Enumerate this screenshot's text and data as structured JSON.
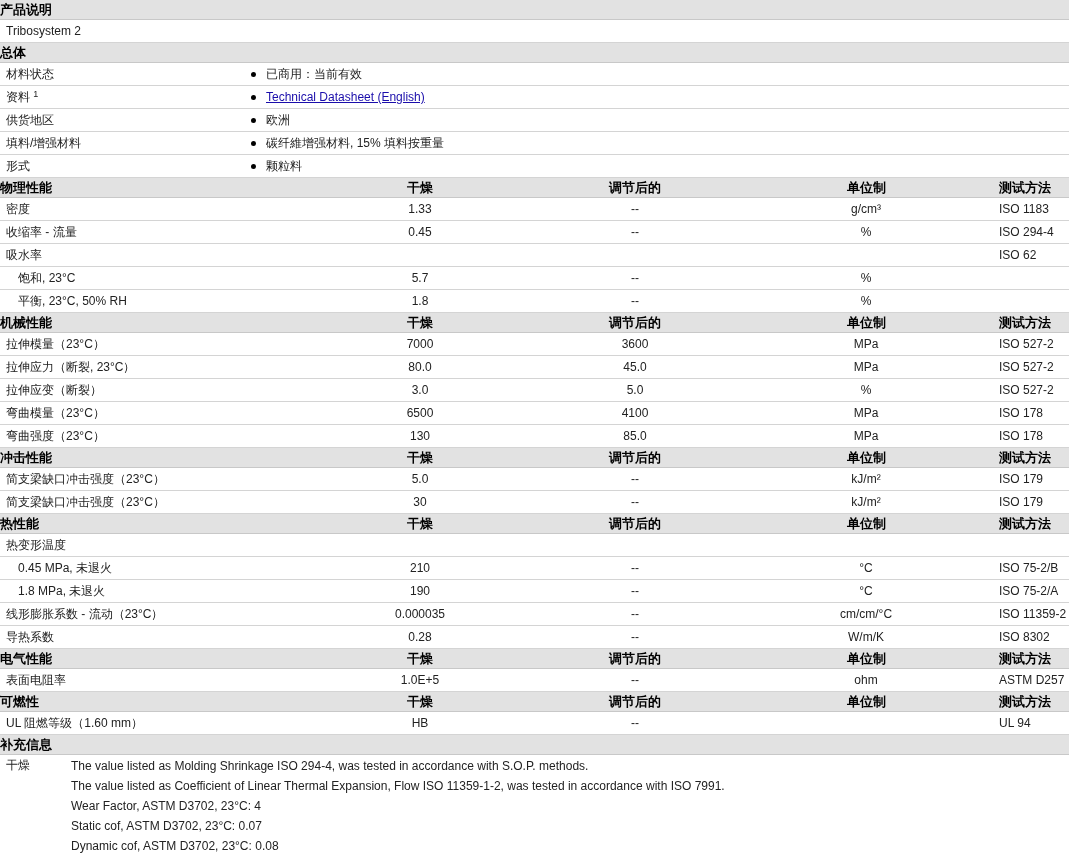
{
  "sections": [
    {
      "kind": "text",
      "title": "产品说明",
      "text": "Tribosystem 2"
    },
    {
      "kind": "general",
      "title": "总体",
      "rows": [
        {
          "label": "材料状态",
          "value": "已商用：当前有效",
          "link": false
        },
        {
          "label": "资料 $^{1}$",
          "value": "Technical Datasheet (English)",
          "link": true
        },
        {
          "label": "供货地区",
          "value": "欧洲",
          "link": false
        },
        {
          "label": "填料/增强材料",
          "value": "碳纤維增强材料, 15% 填料按重量",
          "link": false
        },
        {
          "label": "形式",
          "value": "颗粒料",
          "link": false
        }
      ]
    },
    {
      "kind": "properties",
      "title": "物理性能",
      "columns": [
        "干燥",
        "调节后的",
        "单位制",
        "测试方法"
      ],
      "rows": [
        {
          "label": "密度",
          "dry": "1.33",
          "conditioned": "--",
          "unit": "g/cm³",
          "method": "ISO 1183"
        },
        {
          "label": "收缩率  - 流量",
          "dry": "0.45",
          "conditioned": "--",
          "unit": "%",
          "method": "ISO 294-4"
        },
        {
          "label": "吸水率",
          "method": "ISO 62",
          "children": [
            {
              "label": "饱和, 23°C",
              "dry": "5.7",
              "conditioned": "--",
              "unit": "%"
            },
            {
              "label": "平衡, 23°C, 50% RH",
              "dry": "1.8",
              "conditioned": "--",
              "unit": "%"
            }
          ]
        }
      ]
    },
    {
      "kind": "properties",
      "title": "机械性能",
      "columns": [
        "干燥",
        "调节后的",
        "单位制",
        "测试方法"
      ],
      "rows": [
        {
          "label": "拉伸模量（23°C）",
          "dry": "7000",
          "conditioned": "3600",
          "unit": "MPa",
          "method": "ISO 527-2"
        },
        {
          "label": "拉伸应力（断裂, 23°C）",
          "dry": "80.0",
          "conditioned": "45.0",
          "unit": "MPa",
          "method": "ISO 527-2"
        },
        {
          "label": "拉伸应变（断裂）",
          "dry": "3.0",
          "conditioned": "5.0",
          "unit": "%",
          "method": "ISO 527-2"
        },
        {
          "label": "弯曲模量（23°C）",
          "dry": "6500",
          "conditioned": "4100",
          "unit": "MPa",
          "method": "ISO 178"
        },
        {
          "label": "弯曲强度（23°C）",
          "dry": "130",
          "conditioned": "85.0",
          "unit": "MPa",
          "method": "ISO 178"
        }
      ]
    },
    {
      "kind": "properties",
      "title": "冲击性能",
      "columns": [
        "干燥",
        "调节后的",
        "单位制",
        "测试方法"
      ],
      "rows": [
        {
          "label": "简支梁缺口冲击强度（23°C）",
          "dry": "5.0",
          "conditioned": "--",
          "unit": "kJ/m²",
          "method": "ISO 179"
        },
        {
          "label": "简支梁缺口冲击强度（23°C）",
          "dry": "30",
          "conditioned": "--",
          "unit": "kJ/m²",
          "method": "ISO 179"
        }
      ]
    },
    {
      "kind": "properties",
      "title": "热性能",
      "columns": [
        "干燥",
        "调节后的",
        "单位制",
        "测试方法"
      ],
      "rows": [
        {
          "label": "热变形温度",
          "children": [
            {
              "label": "0.45 MPa, 未退火",
              "dry": "210",
              "conditioned": "--",
              "unit": "°C",
              "method": "ISO 75-2/B"
            },
            {
              "label": "1.8 MPa, 未退火",
              "dry": "190",
              "conditioned": "--",
              "unit": "°C",
              "method": "ISO 75-2/A"
            }
          ]
        },
        {
          "label": "线形膨胀系数  - 流动（23°C）",
          "dry": "0.000035",
          "conditioned": "--",
          "unit": "cm/cm/°C",
          "method": "ISO 11359-2"
        },
        {
          "label": "导热系数",
          "dry": "0.28",
          "conditioned": "--",
          "unit": "W/m/K",
          "method": "ISO 8302"
        }
      ]
    },
    {
      "kind": "properties",
      "title": "电气性能",
      "columns": [
        "干燥",
        "调节后的",
        "单位制",
        "测试方法"
      ],
      "rows": [
        {
          "label": "表面电阻率",
          "dry": "1.0E+5",
          "conditioned": "--",
          "unit": "ohm",
          "method": "ASTM D257"
        }
      ]
    },
    {
      "kind": "properties",
      "title": "可燃性",
      "columns": [
        "干燥",
        "调节后的",
        "单位制",
        "测试方法"
      ],
      "rows": [
        {
          "label": "UL 阻燃等级（1.60 mm）",
          "dry": "HB",
          "conditioned": "--",
          "method": "UL 94"
        }
      ]
    },
    {
      "kind": "notes",
      "title": "补充信息",
      "label": "干燥",
      "lines": [
        "The value listed as Molding Shrinkage ISO 294-4, was tested in accordance with S.O.P. methods.",
        "The value listed as Coefficient of Linear Thermal Expansion, Flow ISO 11359-1-2, was tested in accordance with ISO 7991.",
        "Wear Factor, ASTM D3702, 23°C: 4",
        "Static cof, ASTM D3702, 23°C: 0.07",
        "Dynamic cof, ASTM D3702, 23°C: 0.08"
      ]
    }
  ]
}
